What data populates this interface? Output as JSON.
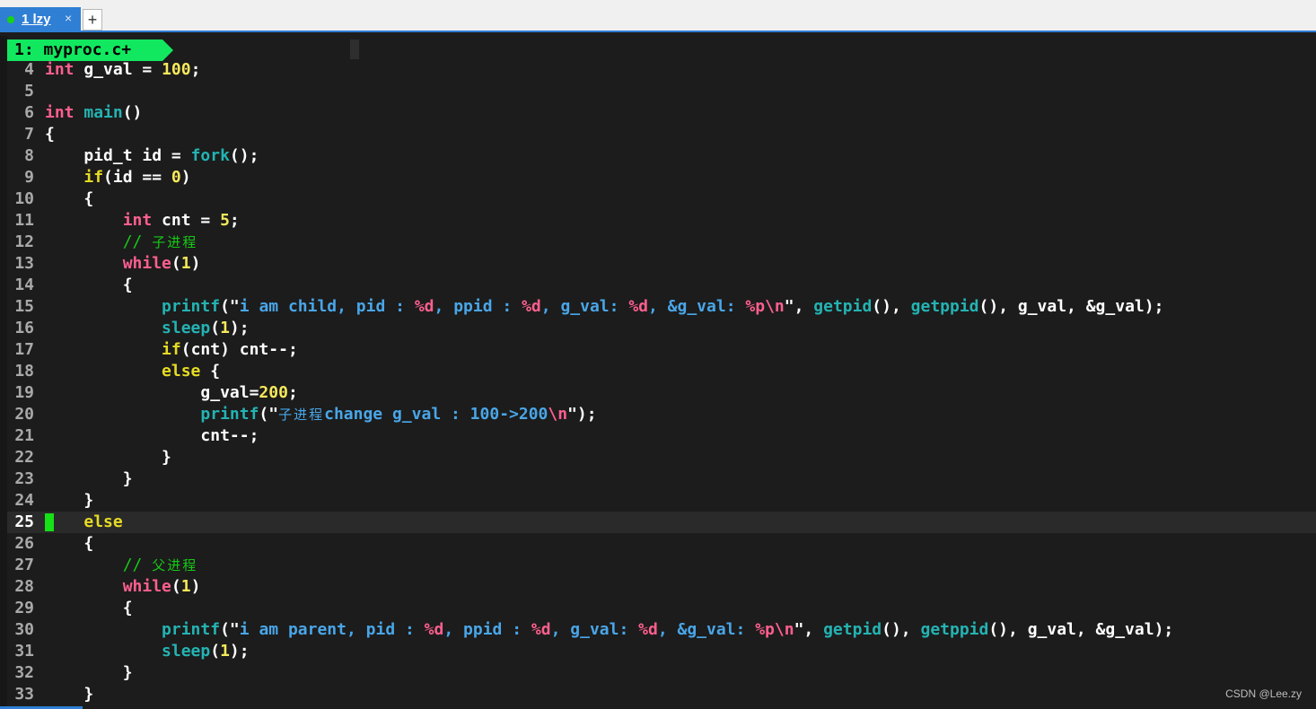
{
  "tab": {
    "label": "1 lzy",
    "close": "×",
    "new": "+"
  },
  "statusline": {
    "label": "1: myproc.c+"
  },
  "current_line": "25",
  "watermark": "CSDN @Lee.zy",
  "colors": {
    "tab_active": "#2f7fd5",
    "status_green": "#12e85f",
    "keyword": "#ff5f8f",
    "control": "#e6db24",
    "function": "#24b3b3",
    "string": "#49a6e8",
    "comment": "#16c916"
  },
  "code": {
    "l4": {
      "n": "4",
      "t": [
        "int",
        " g_val = ",
        "100",
        ";"
      ]
    },
    "l5": {
      "n": "5"
    },
    "l6": {
      "n": "6",
      "t": [
        "int",
        " ",
        "main",
        "()"
      ]
    },
    "l7": {
      "n": "7",
      "t": [
        "{"
      ]
    },
    "l8": {
      "n": "8",
      "t": [
        "    pid_t id = ",
        "fork",
        "();"
      ]
    },
    "l9": {
      "n": "9",
      "t": [
        "    ",
        "if",
        "(id == ",
        "0",
        ")"
      ]
    },
    "l10": {
      "n": "10",
      "t": [
        "    {"
      ]
    },
    "l11": {
      "n": "11",
      "t": [
        "        ",
        "int",
        " cnt = ",
        "5",
        ";"
      ]
    },
    "l12": {
      "n": "12",
      "t": [
        "        ",
        "// ",
        "子进程"
      ]
    },
    "l13": {
      "n": "13",
      "t": [
        "        ",
        "while",
        "(",
        "1",
        ")"
      ]
    },
    "l14": {
      "n": "14",
      "t": [
        "        {"
      ]
    },
    "l15": {
      "n": "15",
      "t": [
        "            ",
        "printf",
        "(\"",
        "i am child, pid : ",
        "%d",
        ", ppid : ",
        "%d",
        ", g_val: ",
        "%d",
        ", &g_val: ",
        "%p",
        "\\n",
        "\", ",
        "getpid",
        "(), ",
        "getppid",
        "(), g_val, &g_val);"
      ]
    },
    "l16": {
      "n": "16",
      "t": [
        "            ",
        "sleep",
        "(",
        "1",
        ");"
      ]
    },
    "l17": {
      "n": "17",
      "t": [
        "            ",
        "if",
        "(cnt) cnt--;"
      ]
    },
    "l18": {
      "n": "18",
      "t": [
        "            ",
        "else",
        " {"
      ]
    },
    "l19": {
      "n": "19",
      "t": [
        "                g_val=",
        "200",
        ";"
      ]
    },
    "l20": {
      "n": "20",
      "t": [
        "                ",
        "printf",
        "(\"",
        "子进程",
        "change g_val : 100->200",
        "\\n",
        "\");"
      ]
    },
    "l21": {
      "n": "21",
      "t": [
        "                cnt--;"
      ]
    },
    "l22": {
      "n": "22",
      "t": [
        "            }"
      ]
    },
    "l23": {
      "n": "23",
      "t": [
        "        }"
      ]
    },
    "l24": {
      "n": "24",
      "t": [
        "    }"
      ]
    },
    "l25": {
      "n": "25",
      "t": [
        "    ",
        "else"
      ]
    },
    "l26": {
      "n": "26",
      "t": [
        "    {"
      ]
    },
    "l27": {
      "n": "27",
      "t": [
        "        ",
        "// ",
        "父进程"
      ]
    },
    "l28": {
      "n": "28",
      "t": [
        "        ",
        "while",
        "(",
        "1",
        ")"
      ]
    },
    "l29": {
      "n": "29",
      "t": [
        "        {"
      ]
    },
    "l30": {
      "n": "30",
      "t": [
        "            ",
        "printf",
        "(\"",
        "i am parent, pid : ",
        "%d",
        ", ppid : ",
        "%d",
        ", g_val: ",
        "%d",
        ", &g_val: ",
        "%p",
        "\\n",
        "\", ",
        "getpid",
        "(), ",
        "getppid",
        "(), g_val, &g_val);"
      ]
    },
    "l31": {
      "n": "31",
      "t": [
        "            ",
        "sleep",
        "(",
        "1",
        ");"
      ]
    },
    "l32": {
      "n": "32",
      "t": [
        "        }"
      ]
    },
    "l33": {
      "n": "33",
      "t": [
        "    }"
      ]
    }
  }
}
